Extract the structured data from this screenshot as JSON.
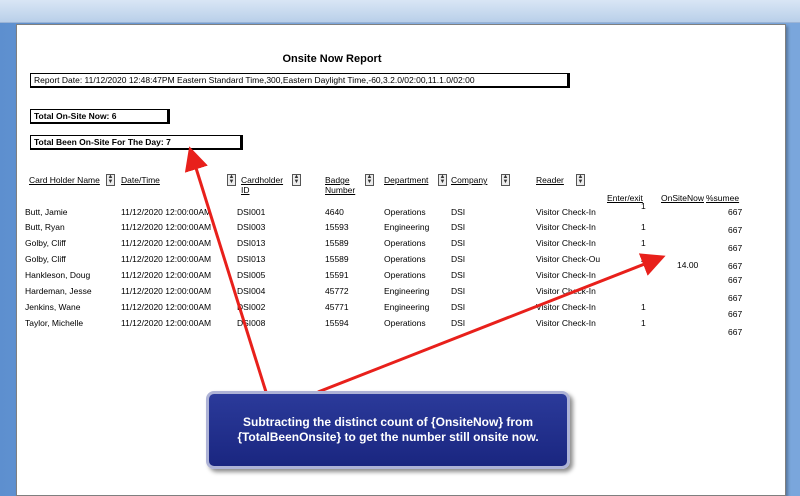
{
  "report": {
    "title": "Onsite Now Report",
    "report_date": "Report Date:  11/12/2020 12:48:47PM  Eastern Standard Time,300,Eastern Daylight Time,-60,3.2.0/02:00,11.1.0/02:00",
    "total_onsite_now": "Total On-Site Now:  6",
    "total_been_onsite": "Total Been On-Site For The Day:  7"
  },
  "columns": {
    "card_holder_name": "Card Holder Name",
    "date_time": "Date/Time",
    "cardholder_id_1": "Cardholder",
    "cardholder_id_2": "ID",
    "badge_number_1": "Badge",
    "badge_number_2": "Number",
    "department": "Department",
    "company": "Company",
    "reader": "Reader",
    "enter_exit": "Enter/exit",
    "onsite_now": "OnSiteNow",
    "sumee": "%sumee"
  },
  "rows": [
    {
      "name": "Butt, Jamie",
      "datetime": "11/12/2020  12:00:00AM",
      "id": "DSI001",
      "badge": "4640",
      "dept": "Operations",
      "company": "DSI",
      "reader": "Visitor Check-In",
      "enter": "1",
      "sumee": "667"
    },
    {
      "name": "Butt, Ryan",
      "datetime": "11/12/2020  12:00:00AM",
      "id": "DSI003",
      "badge": "15593",
      "dept": "Engineering",
      "company": "DSI",
      "reader": "Visitor Check-In",
      "enter": "1",
      "sumee": "667"
    },
    {
      "name": "Golby, Cliff",
      "datetime": "11/12/2020  12:00:00AM",
      "id": "DSI013",
      "badge": "15589",
      "dept": "Operations",
      "company": "DSI",
      "reader": "Visitor Check-In",
      "enter": "1",
      "sumee": "667"
    },
    {
      "name": "Golby, Cliff",
      "datetime": "11/12/2020  12:00:00AM",
      "id": "DSI013",
      "badge": "15589",
      "dept": "Operations",
      "company": "DSI",
      "reader": "Visitor Check-Ou",
      "enter": "2",
      "sumee": "667"
    },
    {
      "name": "Hankleson, Doug",
      "datetime": "11/12/2020  12:00:00AM",
      "id": "DSI005",
      "badge": "15591",
      "dept": "Operations",
      "company": "DSI",
      "reader": "Visitor Check-In",
      "enter": "",
      "sumee": "667"
    },
    {
      "name": "Hardeman, Jesse",
      "datetime": "11/12/2020  12:00:00AM",
      "id": "DSI004",
      "badge": "45772",
      "dept": "Engineering",
      "company": "DSI",
      "reader": "Visitor Check-In",
      "enter": "",
      "sumee": "667"
    },
    {
      "name": "Jenkins, Wane",
      "datetime": "11/12/2020  12:00:00AM",
      "id": "DSI002",
      "badge": "45771",
      "dept": "Engineering",
      "company": "DSI",
      "reader": "Visitor Check-In",
      "enter": "1",
      "sumee": "667"
    },
    {
      "name": "Taylor, Michelle",
      "datetime": "11/12/2020  12:00:00AM",
      "id": "DSI008",
      "badge": "15594",
      "dept": "Operations",
      "company": "DSI",
      "reader": "Visitor Check-In",
      "enter": "1",
      "sumee": "667"
    }
  ],
  "onsite_value": "14.00",
  "callout": {
    "text": "Subtracting the distinct count of {OnsiteNow} from {TotalBeenOnsite} to get the number still onsite now."
  },
  "colors": {
    "arrow": "#e8201b",
    "callout_bg": "#1f2b8a",
    "background": "#7aa6dc"
  }
}
